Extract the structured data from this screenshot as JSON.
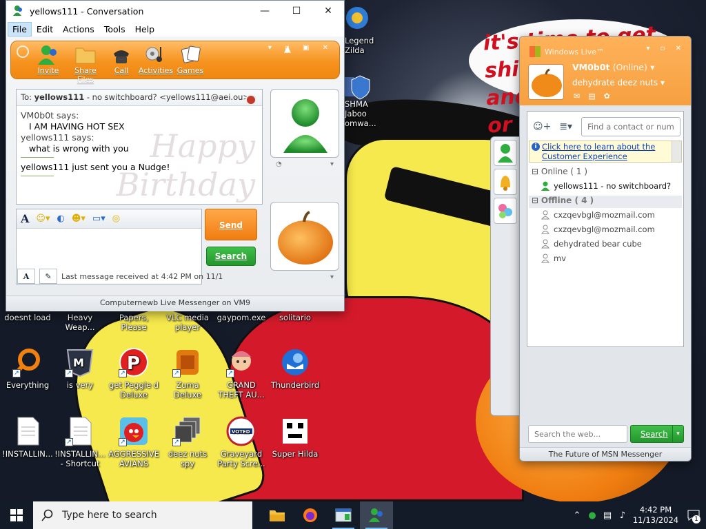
{
  "desktop": {
    "background_text": [
      "it's time to get shit",
      "and",
      "or t"
    ],
    "icons": [
      {
        "label": "Legend\nZilda",
        "icon": "game-icon"
      },
      {
        "label": "SHMA\nJaboo\nomwa...",
        "icon": "shield-icon"
      },
      {
        "label": "doesnt load",
        "icon": "app-icon"
      },
      {
        "label": "Heavy\nWeap...",
        "icon": "app-icon"
      },
      {
        "label": "Papers, Please",
        "icon": "app-icon"
      },
      {
        "label": "VLC media\nplayer",
        "icon": "vlc-icon"
      },
      {
        "label": "gaypom.exe",
        "icon": "exe-icon"
      },
      {
        "label": "solitario",
        "icon": "cards-icon"
      },
      {
        "label": "Everything",
        "icon": "search-icon"
      },
      {
        "label": "is very",
        "icon": "logo-icon"
      },
      {
        "label": "get Peggle d\nDeluxe",
        "icon": "peggle-icon"
      },
      {
        "label": "Zuma Deluxe",
        "icon": "zuma-icon"
      },
      {
        "label": "GRAND\nTHEFT AU...",
        "icon": "anime-icon"
      },
      {
        "label": "Thunderbird",
        "icon": "thunderbird-icon"
      },
      {
        "label": "!INSTALLIN...",
        "icon": "document-icon"
      },
      {
        "label": "!INSTALLIN...\n- Shortcut",
        "icon": "document-icon"
      },
      {
        "label": "AGGRESSIVE\nAVIANS",
        "icon": "angry-bird-icon"
      },
      {
        "label": "deez nuts spy",
        "icon": "window-stack-icon"
      },
      {
        "label": "Graveyard\nParty Scre...",
        "icon": "voted-sticker-icon"
      },
      {
        "label": "Super Hilda",
        "icon": "pixel-icon"
      }
    ]
  },
  "conversation": {
    "title": "yellows111 - Conversation",
    "menu": [
      "File",
      "Edit",
      "Actions",
      "Tools",
      "Help"
    ],
    "toolbar": [
      {
        "label": "Invite",
        "icon": "invite-icon"
      },
      {
        "label": "Share Files",
        "icon": "folder-icon"
      },
      {
        "label": "Call",
        "icon": "phone-icon"
      },
      {
        "label": "Activities",
        "icon": "activities-icon"
      },
      {
        "label": "Games",
        "icon": "games-icon"
      }
    ],
    "to_prefix": "To:",
    "to_name": "yellows111",
    "to_detail": "- no switchboard? <yellows111@aei.ou>",
    "history": [
      {
        "says": "VM0b0t says:",
        "text": "I AM HAVING HOT SEX"
      },
      {
        "says": "yellows111 says:",
        "text": "what is wrong with you"
      }
    ],
    "nudge": "yellows111 just sent you a Nudge!",
    "background_deco": "Happy\nBirthday",
    "send_label": "Send",
    "search_label": "Search",
    "last_message": "Last message received at 4:42 PM on 11/1",
    "footer": "Computernewb Live Messenger on VM9"
  },
  "messenger": {
    "title": "Windows Live™",
    "display_name": "VM0b0t",
    "status": "(Online)",
    "psm": "dehydrate deez nuts",
    "search_placeholder": "Find a contact or number...",
    "banner": "Click here to learn about the Customer Experience",
    "online_group": "Online ( 1 )",
    "offline_group": "Offline ( 4 )",
    "online_contacts": [
      "yellows111 - no switchboard?"
    ],
    "offline_contacts": [
      "cxzqevbgl@mozmail.com",
      "cxzqevbgl@mozmail.com",
      "dehydrated bear cube",
      "mv"
    ],
    "web_search_placeholder": "Search the web...",
    "web_search_button": "Search",
    "footer": "The Future of MSN Messenger"
  },
  "taskbar": {
    "search_placeholder": "Type here to search",
    "time": "4:42 PM",
    "date": "11/13/2024",
    "notification_count": "1"
  },
  "colors": {
    "msn_orange": "#f6931e",
    "msn_green": "#24962c",
    "link_blue": "#0a3fc2",
    "taskbar": "#131b28"
  }
}
